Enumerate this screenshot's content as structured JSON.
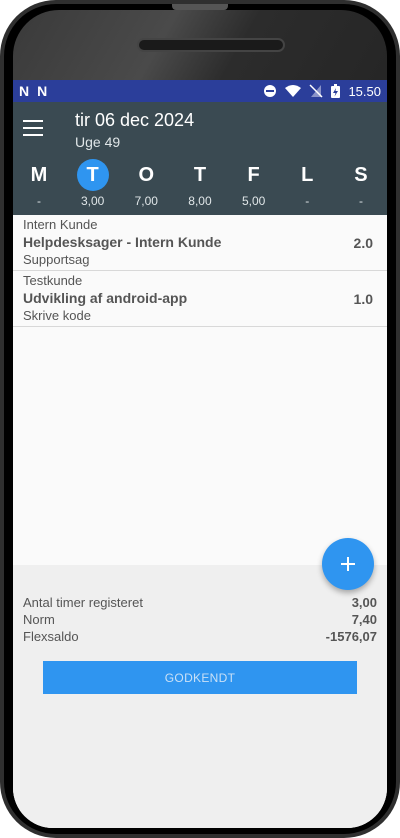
{
  "status_bar": {
    "time": "15.50",
    "left_icons": [
      "N",
      "N"
    ],
    "icons": [
      "do-not-disturb-icon",
      "wifi-icon",
      "no-sim-icon",
      "battery-icon"
    ]
  },
  "header": {
    "date": "tir 06 dec 2024",
    "week": "Uge 49"
  },
  "week_days": [
    {
      "letter": "M",
      "hours": "-"
    },
    {
      "letter": "T",
      "hours": "3,00",
      "selected": true
    },
    {
      "letter": "O",
      "hours": "7,00"
    },
    {
      "letter": "T",
      "hours": "8,00"
    },
    {
      "letter": "F",
      "hours": "5,00"
    },
    {
      "letter": "L",
      "hours": "-"
    },
    {
      "letter": "S",
      "hours": "-"
    }
  ],
  "entries": [
    {
      "customer": "Intern Kunde",
      "task": "Helpdesksager - Intern Kunde",
      "hours": "2.0",
      "description": "Supportsag"
    },
    {
      "customer": "Testkunde",
      "task": "Udvikling af android-app",
      "hours": "1.0",
      "description": "Skrive kode"
    }
  ],
  "summary": {
    "registered_label": "Antal timer registeret",
    "registered_value": "3,00",
    "norm_label": "Norm",
    "norm_value": "7,40",
    "flex_label": "Flexsaldo",
    "flex_value": "-1576,07"
  },
  "approve_button": "GODKENDT",
  "colors": {
    "status_bar": "#2b3e9a",
    "app_bar": "#3a4a52",
    "accent": "#2f95f0"
  }
}
